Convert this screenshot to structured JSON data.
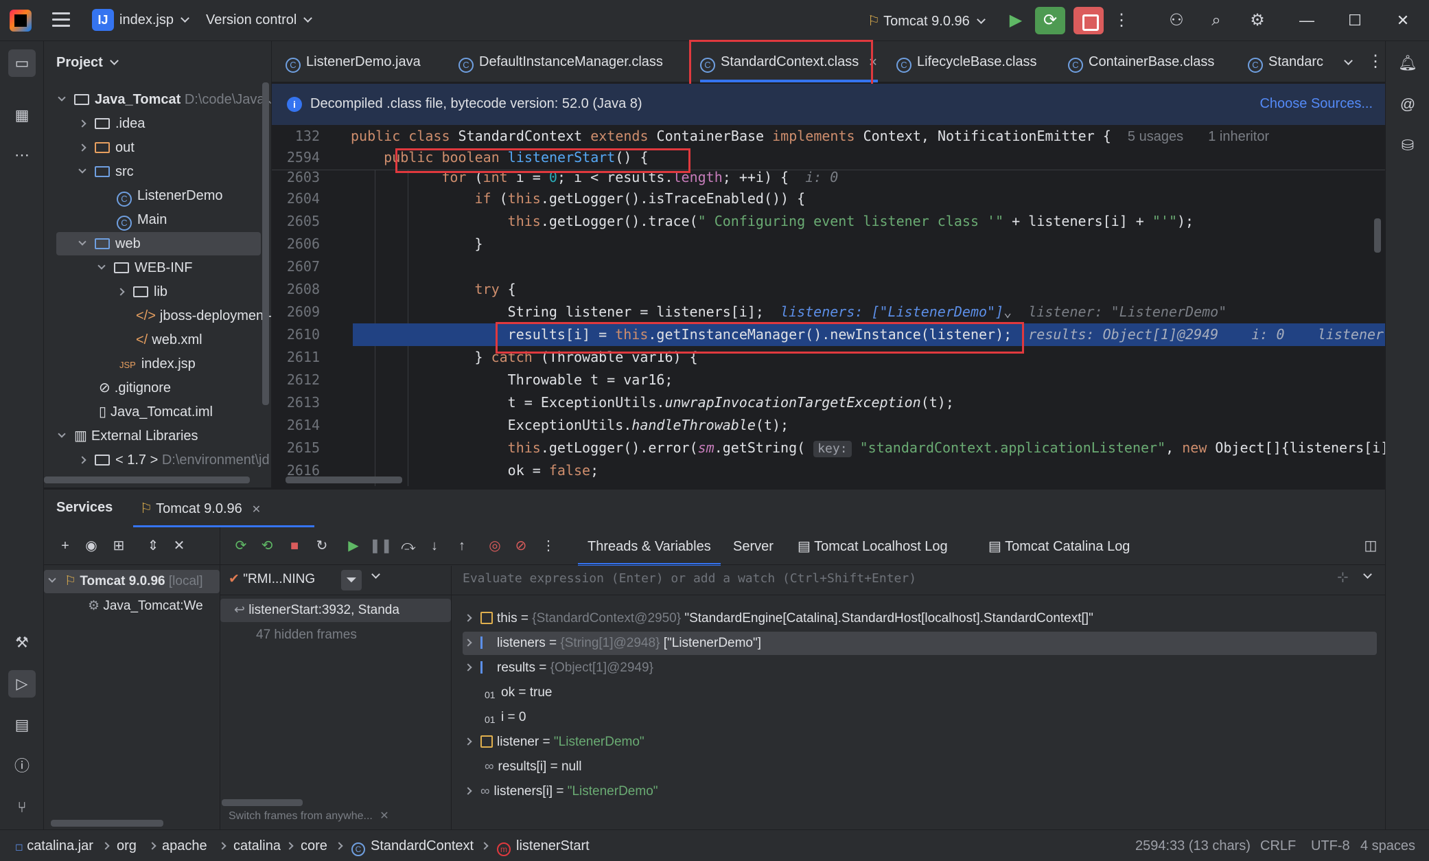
{
  "titlebar": {
    "project_badge": "IJ",
    "project_name": "index.jsp",
    "vcs_label": "Version control",
    "run_config": "Tomcat 9.0.96"
  },
  "project_panel": {
    "title": "Project",
    "items": [
      {
        "label": "Java_Tomcat",
        "path": "D:\\code\\Java\\Ja"
      },
      {
        "label": ".idea"
      },
      {
        "label": "out"
      },
      {
        "label": "src"
      },
      {
        "label": "ListenerDemo"
      },
      {
        "label": "Main"
      },
      {
        "label": "web"
      },
      {
        "label": "WEB-INF"
      },
      {
        "label": "lib"
      },
      {
        "label": "jboss-deployment-s"
      },
      {
        "label": "web.xml"
      },
      {
        "label": "index.jsp",
        "prefix": "JSP"
      },
      {
        "label": ".gitignore"
      },
      {
        "label": "Java_Tomcat.iml"
      },
      {
        "label": "External Libraries"
      },
      {
        "label": "< 1.7 >",
        "path": "D:\\environment\\jd"
      }
    ]
  },
  "editor_tabs": [
    {
      "label": "ListenerDemo.java"
    },
    {
      "label": "DefaultInstanceManager.class"
    },
    {
      "label": "StandardContext.class"
    },
    {
      "label": "LifecycleBase.class"
    },
    {
      "label": "ContainerBase.class"
    },
    {
      "label": "Standarc"
    }
  ],
  "banner": {
    "text": "Decompiled .class file, bytecode version: 52.0 (Java 8)",
    "action": "Choose Sources..."
  },
  "code": {
    "sticky1": {
      "ln": "132",
      "usages": "5 usages",
      "inheritors": "1 inheritor"
    },
    "sticky2": {
      "ln": "2594"
    },
    "lines": [
      {
        "ln": "2603"
      },
      {
        "ln": "2604"
      },
      {
        "ln": "2605"
      },
      {
        "ln": "2606"
      },
      {
        "ln": "2607"
      },
      {
        "ln": "2608"
      },
      {
        "ln": "2609"
      },
      {
        "ln": "2610"
      },
      {
        "ln": "2611"
      },
      {
        "ln": "2612"
      },
      {
        "ln": "2613"
      },
      {
        "ln": "2614"
      },
      {
        "ln": "2615"
      },
      {
        "ln": "2616"
      }
    ],
    "hints": {
      "for_i": "i: 0",
      "listeners": "listeners: [\"ListenerDemo\"]",
      "listener": "listener: \"ListenerDemo\"",
      "results": "results: Object[1]@2949",
      "i": "i: 0",
      "trail": "listener",
      "key": "key:"
    }
  },
  "services": {
    "title": "Services",
    "tab_label": "Tomcat 9.0.96",
    "tree": {
      "server": "Tomcat 9.0.96",
      "server_suffix": "[local]",
      "artifact": "Java_Tomcat:We"
    },
    "thread_filter": "\"RMI...NING",
    "frame": "listenerStart:3932, Standa",
    "hidden_frames": "47 hidden frames",
    "switch_frames": "Switch frames from anywhe...",
    "debug_tabs": [
      "Threads & Variables",
      "Server",
      "Tomcat Localhost Log",
      "Tomcat Catalina Log"
    ],
    "eval_placeholder": "Evaluate expression (Enter) or add a watch (Ctrl+Shift+Enter)",
    "variables": [
      {
        "name": "this",
        "type": "{StandardContext@2950}",
        "value": "\"StandardEngine[Catalina].StandardHost[localhost].StandardContext[]\""
      },
      {
        "name": "listeners",
        "type": "{String[1]@2948}",
        "value": "[\"ListenerDemo\"]"
      },
      {
        "name": "results",
        "type": "{Object[1]@2949}",
        "value": ""
      },
      {
        "name": "ok",
        "type": "",
        "value": "true"
      },
      {
        "name": "i",
        "type": "",
        "value": "0"
      },
      {
        "name": "listener",
        "type": "",
        "value": "\"ListenerDemo\""
      },
      {
        "name": "results[i]",
        "type": "",
        "value": "null"
      },
      {
        "name": "listeners[i]",
        "type": "",
        "value": "\"ListenerDemo\""
      }
    ]
  },
  "statusbar": {
    "crumbs": [
      "catalina.jar",
      "org",
      "apache",
      "catalina",
      "core",
      "StandardContext",
      "listenerStart"
    ],
    "position": "2594:33 (13 chars)",
    "line_sep": "CRLF",
    "encoding": "UTF-8",
    "indent": "4 spaces"
  },
  "colors": {
    "accent": "#3574f0",
    "execution_line": "#214283",
    "highlight_box": "#e0393e",
    "run_green": "#4e9a52",
    "stop_red": "#db5c5c"
  }
}
